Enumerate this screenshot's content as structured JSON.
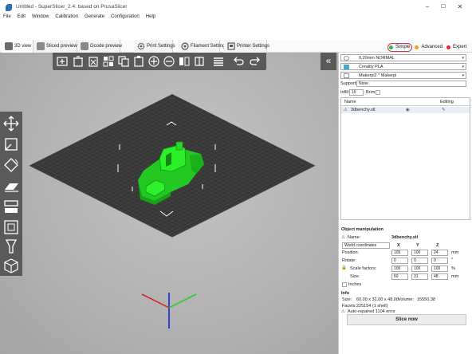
{
  "window": {
    "title": "Untitled - SuperSlicer_2.4: based on PrusaSlicer",
    "controls": [
      "–",
      "☐",
      "✕"
    ]
  },
  "menubar": [
    "File",
    "Edit",
    "Window",
    "Calibration",
    "Generate",
    "Configuration",
    "Help"
  ],
  "tabs": [
    {
      "label": "3D view",
      "active": true
    },
    {
      "label": "Sliced preview",
      "active": false
    },
    {
      "label": "Gcode preview",
      "active": false
    },
    {
      "label": "Print Settings",
      "active": false
    },
    {
      "label": "Filament Settings",
      "active": false
    },
    {
      "label": "Printer Settings",
      "active": false
    }
  ],
  "modes": [
    {
      "label": "Simple",
      "color": "#38b24a",
      "selected": true
    },
    {
      "label": "Advanced",
      "color": "#f2a21b",
      "selected": false
    },
    {
      "label": "Expert",
      "color": "#e0242a",
      "selected": false
    }
  ],
  "sidebar": {
    "collapse_label": "«",
    "print_preset": "0.20mm NORMAL",
    "filament_preset": "Creality PLA",
    "printer_preset": "Makerpi2 * Makerpi",
    "supports_label": "Supports:",
    "supports_value": "None",
    "infill_label": "Infill:",
    "infill_value": "15",
    "brim_label": "Brim:",
    "object_list": {
      "col_name": "Name",
      "col_editing": "Editing",
      "rows": [
        {
          "name": "3dbenchy.stl"
        }
      ]
    },
    "object_manipulation": {
      "title": "Object manipulation",
      "name_label": "Name:",
      "name_value": "3dbenchy.stl",
      "coords": "World coordinates",
      "axes": [
        "X",
        "Y",
        "Z"
      ],
      "position_label": "Position:",
      "position": [
        "105",
        "100",
        "24"
      ],
      "position_unit": "mm",
      "rotate_label": "Rotate:",
      "rotate": [
        "0",
        "0",
        "0"
      ],
      "rotate_unit": "°",
      "scale_label": "Scale factors:",
      "scale": [
        "100",
        "100",
        "100"
      ],
      "scale_unit": "%",
      "size_label": "Size:",
      "size": [
        "60",
        "31",
        "48"
      ],
      "size_unit": "mm",
      "inches_label": "Inches"
    },
    "info": {
      "title": "Info",
      "size_label": "Size:",
      "size_value": "60.00 x 31.00 x 48.00",
      "volume_label": "Volume:",
      "volume_value": "15550.38",
      "facets_label": "Facets:",
      "facets_value": "225154 (1 shell)",
      "repair_text": "Auto-repaired 1104 error"
    },
    "slice_button": "Slice now"
  },
  "colors": {
    "model": "#25e325",
    "toolbar": "#5a5a5a",
    "bed": "#3b3b3b",
    "selection_ring": "#d0344f"
  }
}
